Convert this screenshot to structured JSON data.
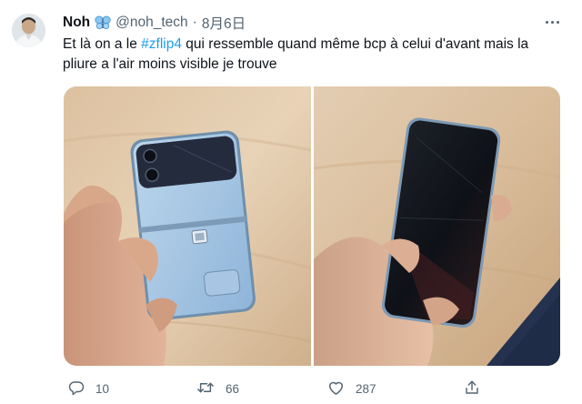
{
  "tweet": {
    "author": {
      "display_name": "Noh",
      "handle": "@noh_tech",
      "name_emoji": "blue-butterfly-emoji"
    },
    "separator": "·",
    "date": "8月6日",
    "text": {
      "before_hashtag": "Et là on a le ",
      "hashtag": "#zflip4",
      "after_hashtag": " qui ressemble quand même bcp à celui d'avant mais la",
      "line2": "pliure a l'air moins visible je trouve"
    },
    "media": [
      {
        "description": "Hand holding a folded blue Galaxy Z Flip4 on a wooden desk"
      },
      {
        "description": "Hand holding an unfolded Galaxy Z Flip4 with dark screen"
      }
    ],
    "actions": {
      "reply_count": "10",
      "retweet_count": "66",
      "like_count": "287"
    },
    "icons": {
      "reply": "reply-icon",
      "retweet": "retweet-icon",
      "like": "heart-icon",
      "share": "share-icon",
      "more": "more-dots-icon"
    },
    "colors": {
      "accent": "#1d9bf0",
      "secondary_text": "#536471",
      "primary_text": "#0f1419"
    }
  }
}
